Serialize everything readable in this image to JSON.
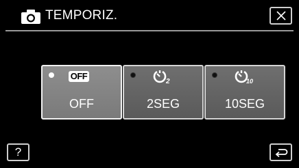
{
  "header": {
    "title": "TEMPORIZ.",
    "mode_icon": "camera-icon",
    "close_icon": "close-icon"
  },
  "options": [
    {
      "label": "OFF",
      "icon": "timer-off-icon",
      "icon_text": "OFF",
      "selected": true
    },
    {
      "label": "2SEG",
      "icon": "timer-2s-icon",
      "icon_subscript": "2",
      "selected": false
    },
    {
      "label": "10SEG",
      "icon": "timer-10s-icon",
      "icon_subscript": "10",
      "selected": false
    }
  ],
  "footer": {
    "help_label": "?",
    "back_icon": "return-icon"
  },
  "colors": {
    "background": "#000000",
    "button_face": "#6f6f6f",
    "button_selected": "#8e8e8e",
    "border": "#d6d6d6",
    "text": "#ffffff"
  }
}
